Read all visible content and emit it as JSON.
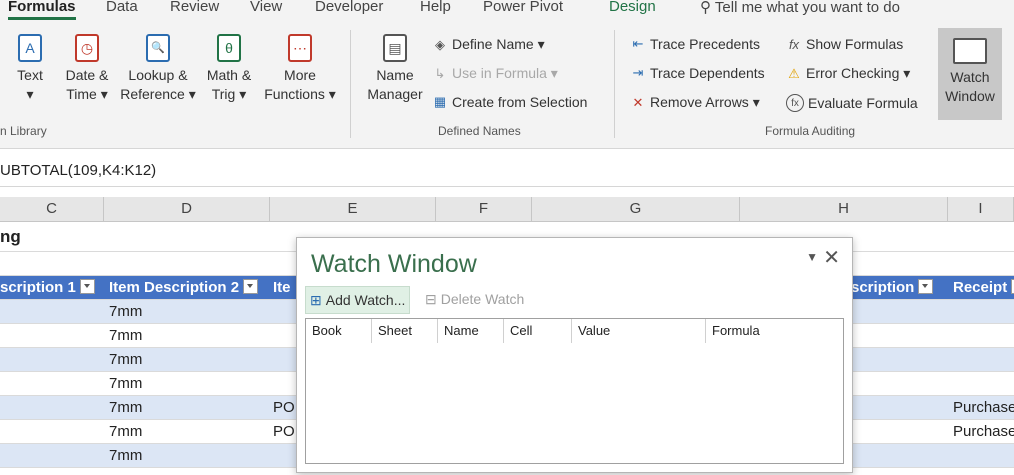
{
  "tabs": [
    "Formulas",
    "Data",
    "Review",
    "View",
    "Developer",
    "Help",
    "Power Pivot",
    "Design"
  ],
  "tell_me": "Tell me what you want to do",
  "ribbon": {
    "function_library": {
      "buttons": [
        {
          "line1": "Text",
          "line2": "▾",
          "icon": "A"
        },
        {
          "line1": "Date &",
          "line2": "Time ▾",
          "icon": "◷"
        },
        {
          "line1": "Lookup &",
          "line2": "Reference ▾",
          "icon": "🔍"
        },
        {
          "line1": "Math &",
          "line2": "Trig ▾",
          "icon": "θ"
        },
        {
          "line1": "More",
          "line2": "Functions ▾",
          "icon": "⋯"
        }
      ],
      "label": "n Library"
    },
    "defined_names": {
      "name_manager_line1": "Name",
      "name_manager_line2": "Manager",
      "define_name": "Define Name ▾",
      "use_in_formula": "Use in Formula ▾",
      "create_from_selection": "Create from Selection",
      "label": "Defined Names"
    },
    "formula_auditing": {
      "trace_precedents": "Trace Precedents",
      "trace_dependents": "Trace Dependents",
      "remove_arrows": "Remove Arrows ▾",
      "show_formulas": "Show Formulas",
      "error_checking": "Error Checking ▾",
      "evaluate_formula": "Evaluate Formula",
      "label": "Formula Auditing"
    },
    "watch_window": {
      "line1": "Watch",
      "line2": "Window"
    }
  },
  "formula_bar": {
    "text": "UBTOTAL(109,K4:K12)"
  },
  "columns": [
    "C",
    "D",
    "E",
    "F",
    "G",
    "H",
    "I"
  ],
  "sheet": {
    "title": "ng",
    "header": {
      "c": "scription 1",
      "d": "Item Description 2",
      "e": "Ite",
      "h": "scription",
      "i": "Receipt"
    },
    "rows": [
      {
        "d": "7mm",
        "e": "",
        "i": ""
      },
      {
        "d": "7mm",
        "e": "",
        "i": ""
      },
      {
        "d": "7mm",
        "e": "",
        "i": ""
      },
      {
        "d": "7mm",
        "e": "",
        "i": ""
      },
      {
        "d": "7mm",
        "e": "PO",
        "i": "Purchase"
      },
      {
        "d": "7mm",
        "e": "PO",
        "i": "Purchase"
      },
      {
        "d": "7mm",
        "e": "",
        "i": ""
      }
    ]
  },
  "watch_window": {
    "title": "Watch Window",
    "add_watch": "Add Watch...",
    "delete_watch": "Delete Watch",
    "columns": [
      "Book",
      "Sheet",
      "Name",
      "Cell",
      "Value",
      "Formula"
    ]
  }
}
